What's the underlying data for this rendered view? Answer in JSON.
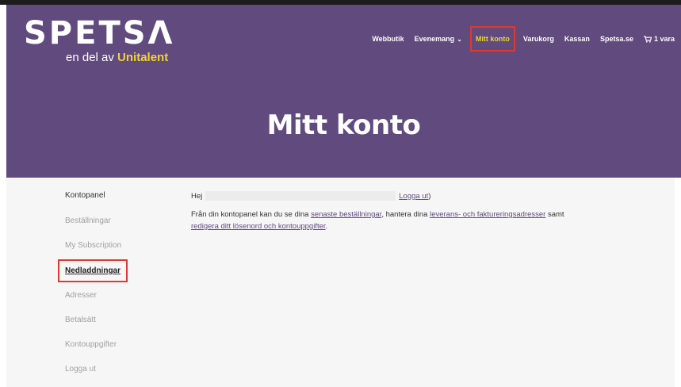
{
  "logo": {
    "word": "SPETSΛ",
    "tagline_prefix": "en del av ",
    "tagline_brand": "Unitalent"
  },
  "nav": {
    "webbutik": "Webbutik",
    "evenemang": "Evenemang",
    "mitt_konto": "Mitt konto",
    "varukorg": "Varukorg",
    "kassan": "Kassan",
    "spetsa": "Spetsa.se",
    "cart_count": "1 vara",
    "chevron": "⌄"
  },
  "hero": {
    "title": "Mitt konto"
  },
  "sidebar": {
    "items": [
      {
        "label": "Kontopanel"
      },
      {
        "label": "Beställningar"
      },
      {
        "label": "My Subscription"
      },
      {
        "label": "Nedladdningar"
      },
      {
        "label": "Adresser"
      },
      {
        "label": "Betalsätt"
      },
      {
        "label": "Kontouppgifter"
      },
      {
        "label": "Logga ut"
      }
    ]
  },
  "main": {
    "greeting": "Hej",
    "logout_link": "Logga ut",
    "logout_suffix": ")",
    "intro_prefix": "Från din kontopanel kan du se dina ",
    "link_orders": "senaste beställningar",
    "intro_mid": ", hantera dina ",
    "link_addresses": "leverans- och faktureringsadresser",
    "intro_suffix": " samt",
    "link_account": "redigera ditt lösenord och kontouppgifter",
    "period": "."
  },
  "colors": {
    "brand_purple": "#614a7e",
    "brand_yellow": "#f2d233",
    "highlight_red": "#e1392b"
  }
}
